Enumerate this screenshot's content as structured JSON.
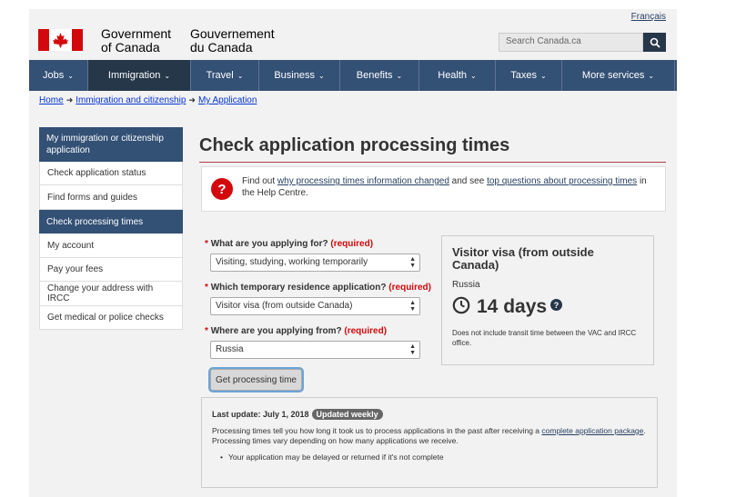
{
  "header": {
    "language_link": "Français",
    "signature_en": [
      "Government",
      "of Canada"
    ],
    "signature_fr": [
      "Gouvernement",
      "du Canada"
    ],
    "search_placeholder": "Search Canada.ca"
  },
  "menu": [
    {
      "label": "Jobs"
    },
    {
      "label": "Immigration"
    },
    {
      "label": "Travel"
    },
    {
      "label": "Business"
    },
    {
      "label": "Benefits"
    },
    {
      "label": "Health"
    },
    {
      "label": "Taxes"
    },
    {
      "label": "More services"
    }
  ],
  "breadcrumb": [
    "Home",
    "Immigration and citizenship",
    "My Application"
  ],
  "sidenav": {
    "heading": "My immigration or citizenship application",
    "items": [
      "Check application status",
      "Find forms and guides",
      "Check processing times",
      "My account",
      "Pay your fees",
      "Change your address with IRCC",
      "Get medical or police checks"
    ]
  },
  "page_title": "Check application processing times",
  "notice": {
    "prefix": "Find out ",
    "link1": "why processing times information changed",
    "middle": " and see ",
    "link2": "top questions about processing times",
    "suffix": " in the Help Centre."
  },
  "form": {
    "required_marker": "*",
    "required_text": "(required)",
    "q1": {
      "label": "What are you applying for?",
      "value": "Visiting, studying, working temporarily"
    },
    "q2": {
      "label": "Which temporary residence application?",
      "value": "Visitor visa (from outside Canada)"
    },
    "q3": {
      "label": "Where are you applying from?",
      "value": "Russia"
    },
    "submit": "Get processing time"
  },
  "result": {
    "title": "Visitor visa (from outside Canada)",
    "country": "Russia",
    "time": "14 days",
    "help": "?",
    "note": "Does not include transit time between the VAC and IRCC office."
  },
  "info": {
    "last_update": "Last update: July 1, 2018",
    "badge": "Updated weekly",
    "text_prefix": "Processing times tell you how long it took us to process applications in the past after receiving a ",
    "text_link": "complete application package",
    "text_suffix": ". Processing times vary depending on how many applications we receive.",
    "bullet": "Your application may be delayed or returned if it's not complete"
  },
  "colors": {
    "brand_red": "#d3080c",
    "nav_blue": "#335075",
    "nav_active": "#26374a"
  }
}
